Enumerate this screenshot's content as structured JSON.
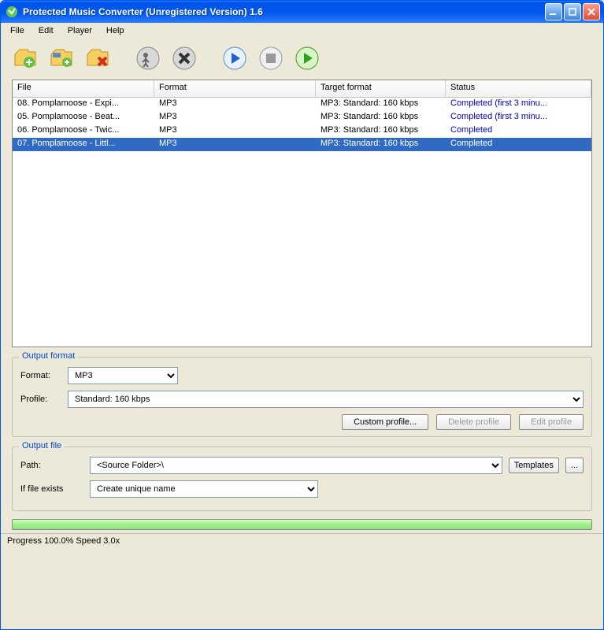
{
  "window": {
    "title": "Protected Music Converter  (Unregistered Version) 1.6"
  },
  "menu": {
    "file": "File",
    "edit": "Edit",
    "player": "Player",
    "help": "Help"
  },
  "table": {
    "headers": {
      "file": "File",
      "format": "Format",
      "target": "Target format",
      "status": "Status"
    },
    "rows": [
      {
        "file": "08. Pomplamoose - Expi...",
        "format": "MP3",
        "target": "MP3: Standard: 160 kbps",
        "status": "Completed (first 3 minu...",
        "selected": false
      },
      {
        "file": "05. Pomplamoose - Beat...",
        "format": "MP3",
        "target": "MP3: Standard: 160 kbps",
        "status": "Completed (first 3 minu...",
        "selected": false
      },
      {
        "file": "06. Pomplamoose - Twic...",
        "format": "MP3",
        "target": "MP3: Standard: 160 kbps",
        "status": "Completed",
        "selected": false
      },
      {
        "file": "07. Pomplamoose - Littl...",
        "format": "MP3",
        "target": "MP3: Standard: 160 kbps",
        "status": "Completed",
        "selected": true
      }
    ]
  },
  "output_format": {
    "title": "Output format",
    "format_label": "Format:",
    "format_value": "MP3",
    "profile_label": "Profile:",
    "profile_value": "Standard: 160 kbps",
    "custom_profile": "Custom profile...",
    "delete_profile": "Delete profile",
    "edit_profile": "Edit profile"
  },
  "output_file": {
    "title": "Output file",
    "path_label": "Path:",
    "path_value": "<Source Folder>\\",
    "templates": "Templates",
    "browse": "...",
    "exists_label": "If file exists",
    "exists_value": "Create unique name"
  },
  "status_bar": "Progress 100.0% Speed 3.0x"
}
